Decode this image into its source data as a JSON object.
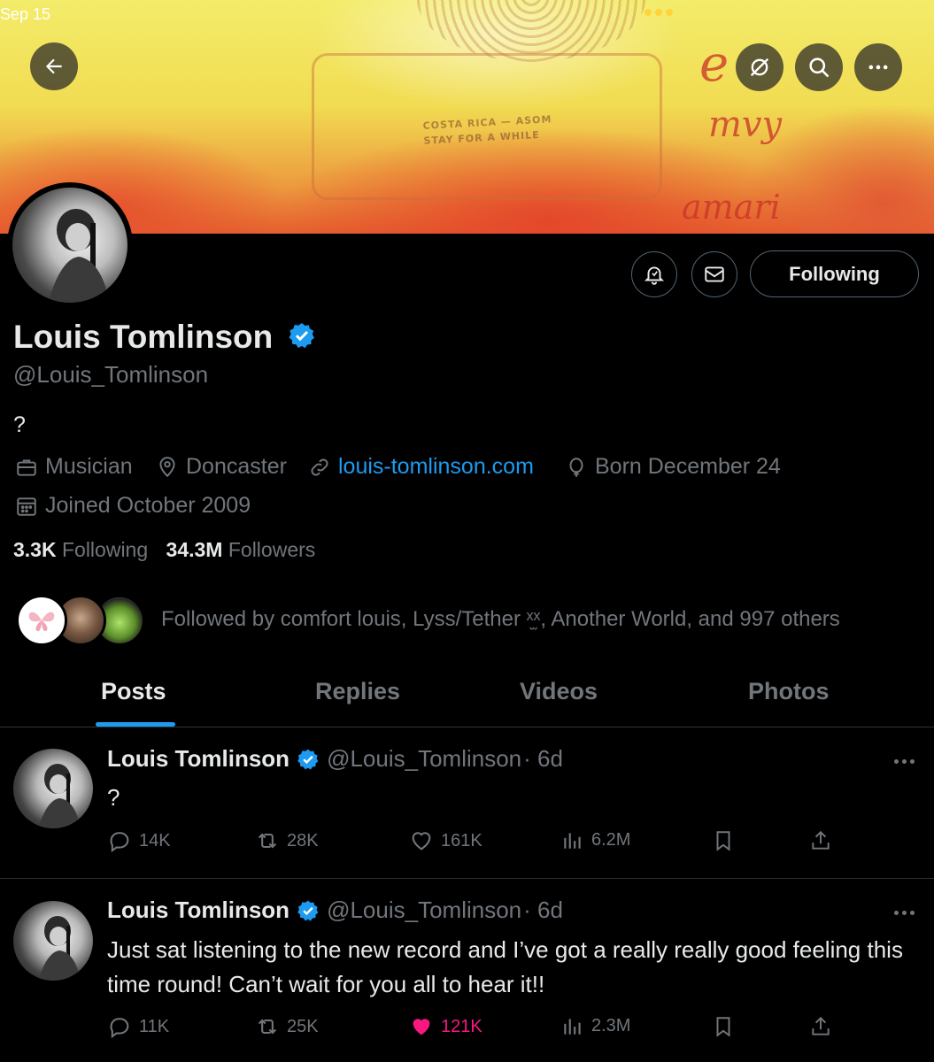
{
  "status_bar": {
    "date": "Sep 15"
  },
  "profile": {
    "name": "Louis Tomlinson",
    "handle": "@Louis_Tomlinson",
    "bio": "?",
    "category": "Musician",
    "location": "Doncaster",
    "website": "louis-tomlinson.com",
    "birthday": "Born December 24",
    "joined": "Joined October 2009",
    "following_count": "3.3K",
    "following_label": "Following",
    "followers_count": "34.3M",
    "followers_label": "Followers",
    "followed_by": "Followed by comfort louis, Lyss/Tether ˣ̫ˣ, Another World, and 997 others",
    "follow_button": "Following"
  },
  "banner": {
    "stamp_line1": "COSTA RICA — ASOM",
    "stamp_line2": "STAY FOR A WHILE"
  },
  "tabs": [
    {
      "label": "Posts",
      "active": true
    },
    {
      "label": "Replies",
      "active": false
    },
    {
      "label": "Videos",
      "active": false
    },
    {
      "label": "Photos",
      "active": false
    }
  ],
  "posts": [
    {
      "name": "Louis Tomlinson",
      "handle": "@Louis_Tomlinson",
      "time": "· 6d",
      "text": "?",
      "replies": "14K",
      "reposts": "28K",
      "likes": "161K",
      "views": "6.2M",
      "liked": false
    },
    {
      "name": "Louis Tomlinson",
      "handle": "@Louis_Tomlinson",
      "time": "· 6d",
      "text": "Just sat listening to the new record and I’ve got a really really good feeling this time round! Can’t wait for you all to hear it!!",
      "replies": "11K",
      "reposts": "25K",
      "likes": "121K",
      "views": "2.3M",
      "liked": true
    }
  ],
  "colors": {
    "background": "#000000",
    "text": "#e7e9ea",
    "muted": "#71767b",
    "accent": "#1d9bf0",
    "like": "#f91880",
    "verified": "#1d9bf0"
  },
  "icons": [
    "back-arrow-icon",
    "no-retweet-icon",
    "search-icon",
    "more-icon",
    "notification-bell-icon",
    "message-icon",
    "verified-badge-icon",
    "briefcase-icon",
    "location-pin-icon",
    "link-icon",
    "balloon-icon",
    "calendar-icon",
    "reply-icon",
    "repost-icon",
    "like-icon",
    "views-icon",
    "bookmark-icon",
    "share-icon"
  ]
}
